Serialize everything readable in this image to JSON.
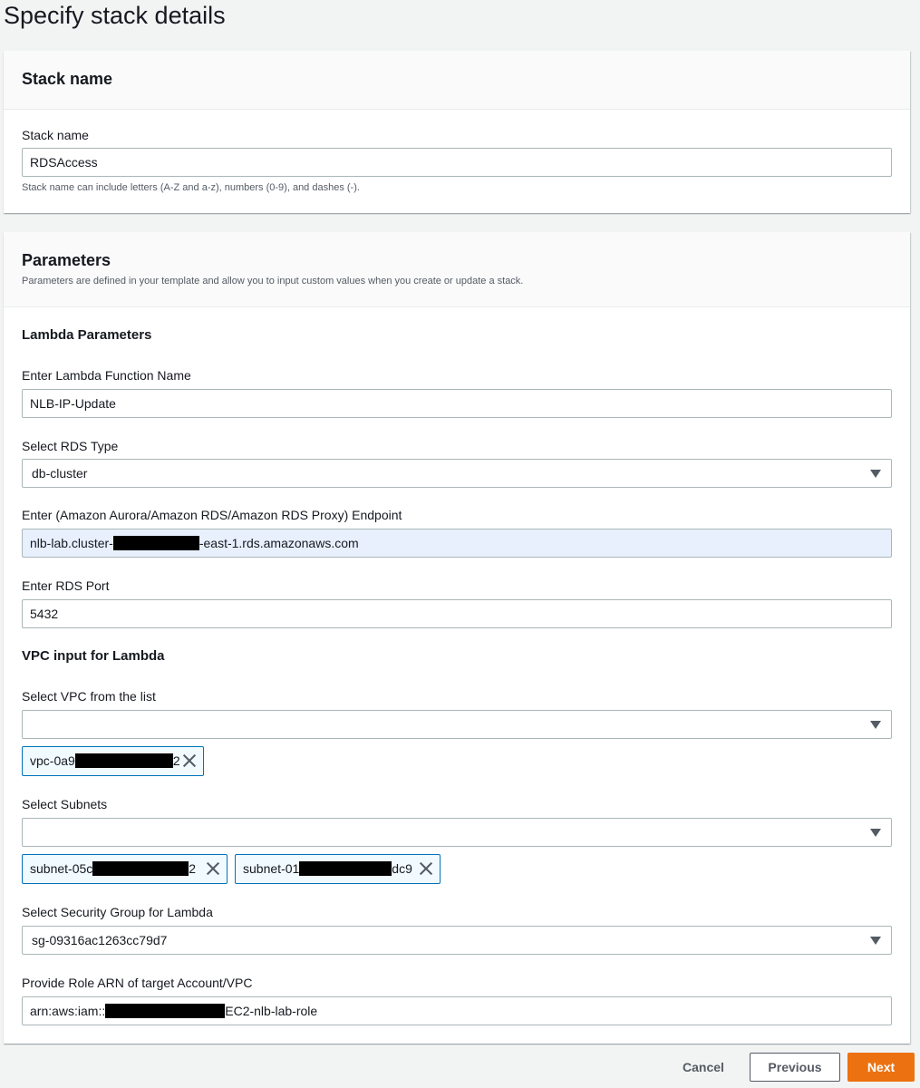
{
  "page": {
    "title": "Specify stack details"
  },
  "stack_name_panel": {
    "heading": "Stack name",
    "label": "Stack name",
    "value": "RDSAccess",
    "hint": "Stack name can include letters (A-Z and a-z), numbers (0-9), and dashes (-)."
  },
  "parameters_panel": {
    "heading": "Parameters",
    "description": "Parameters are defined in your template and allow you to input custom values when you create or update a stack.",
    "lambda_section": "Lambda Parameters",
    "function_name": {
      "label": "Enter Lambda Function Name",
      "value": "NLB-IP-Update"
    },
    "rds_type": {
      "label": "Select RDS Type",
      "value": "db-cluster"
    },
    "endpoint": {
      "label": "Enter (Amazon Aurora/Amazon RDS/Amazon RDS Proxy) Endpoint",
      "value_prefix": "nlb-lab.cluster-",
      "value_suffix": "-east-1.rds.amazonaws.com"
    },
    "rds_port": {
      "label": "Enter RDS Port",
      "value": "5432"
    },
    "vpc_section": "VPC input for Lambda",
    "vpc": {
      "label": "Select VPC from the list",
      "token_prefix": "vpc-0a9",
      "token_suffix": "2"
    },
    "subnets": {
      "label": "Select Subnets",
      "tokens": [
        {
          "prefix": "subnet-05c",
          "suffix": "2"
        },
        {
          "prefix": "subnet-01",
          "suffix": "dc9"
        }
      ]
    },
    "security_group": {
      "label": "Select Security Group for Lambda",
      "value": "sg-09316ac1263cc79d7"
    },
    "role_arn": {
      "label": "Provide Role ARN of target Account/VPC",
      "value_prefix": "arn:aws:iam::",
      "value_suffix": "EC2-nlb-lab-role"
    }
  },
  "footer": {
    "cancel": "Cancel",
    "previous": "Previous",
    "next": "Next"
  },
  "colors": {
    "primary_button": "#ec7211",
    "token_border": "#0073bb",
    "token_bg": "#f1faff",
    "autofill_bg": "#e8f0fe"
  }
}
